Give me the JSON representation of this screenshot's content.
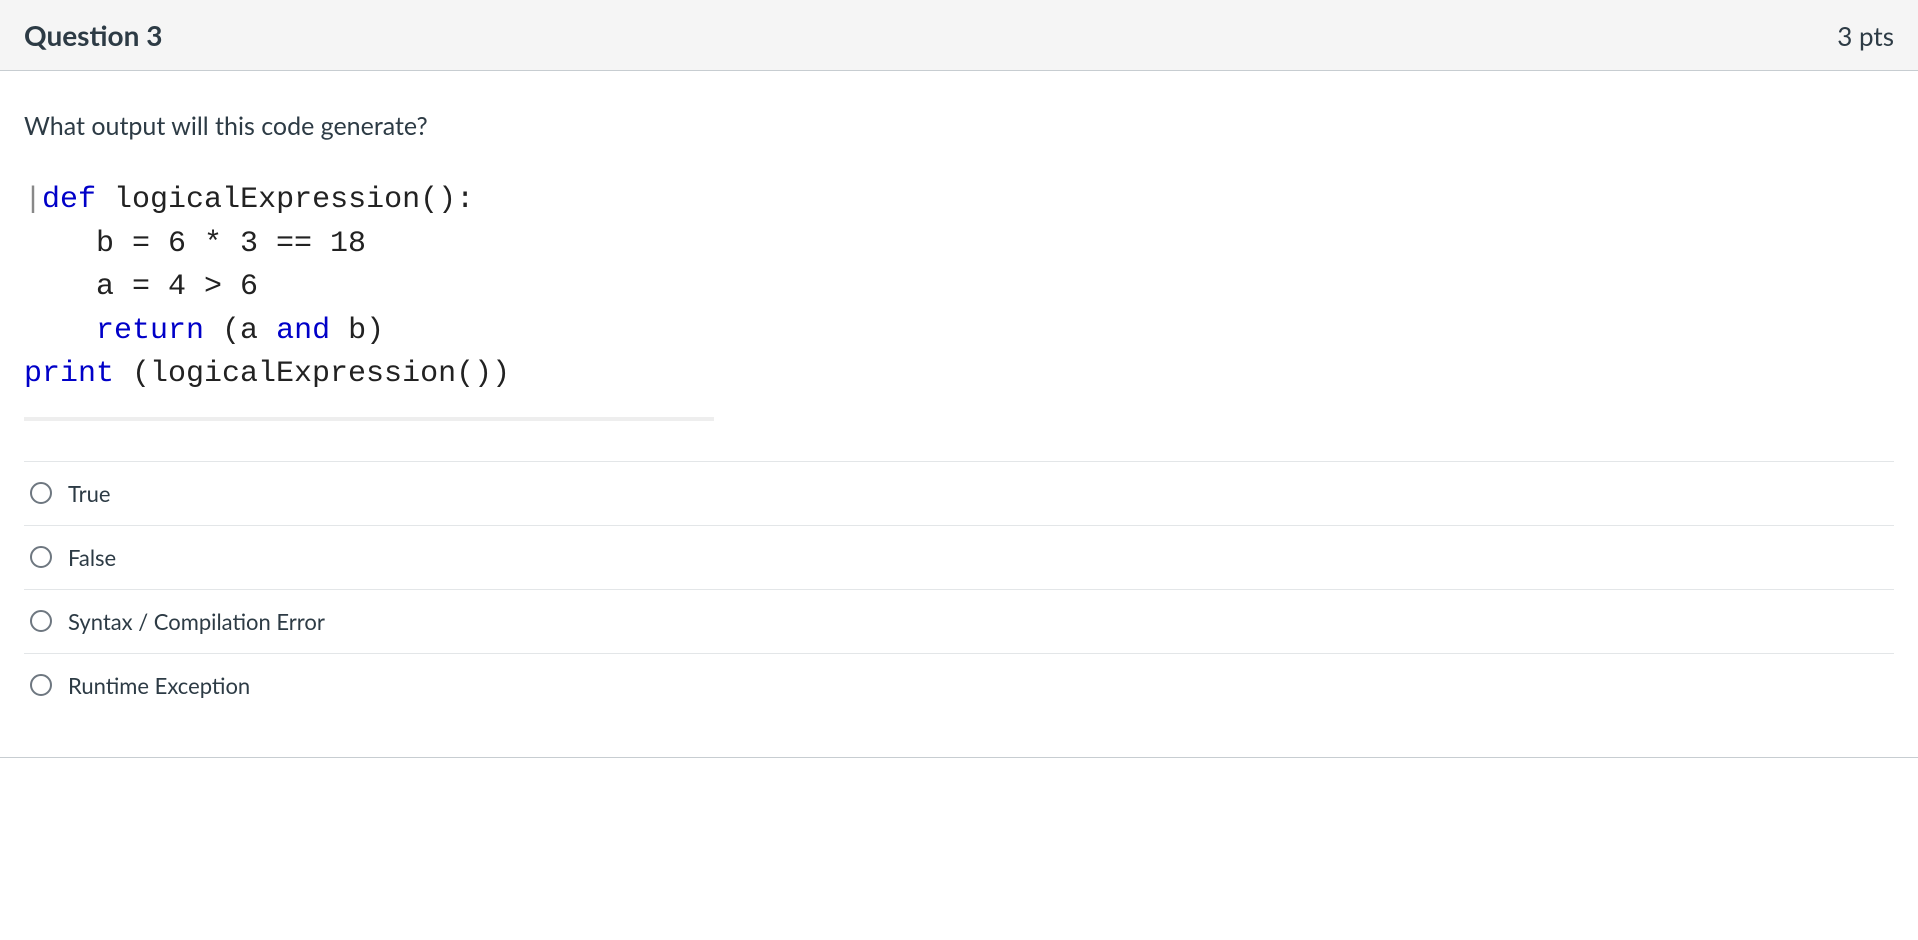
{
  "header": {
    "title": "Question 3",
    "points": "3 pts"
  },
  "prompt": "What output will this code generate?",
  "code": {
    "line1_cursor": "|",
    "line1_def": "def",
    "line1_space1": " ",
    "line1_fn": "logicalExpression",
    "line1_tail": "():",
    "line2": "    b = 6 * 3 == 18",
    "line3": "    a = 4 > 6",
    "line4_indent": "    ",
    "line4_return": "return",
    "line4_mid1": " (a ",
    "line4_and": "and",
    "line4_mid2": " b)",
    "line5_print": "print",
    "line5_tail": " (logicalExpression())"
  },
  "answers": [
    {
      "label": "True"
    },
    {
      "label": "False"
    },
    {
      "label": "Syntax / Compilation Error"
    },
    {
      "label": "Runtime Exception"
    }
  ]
}
